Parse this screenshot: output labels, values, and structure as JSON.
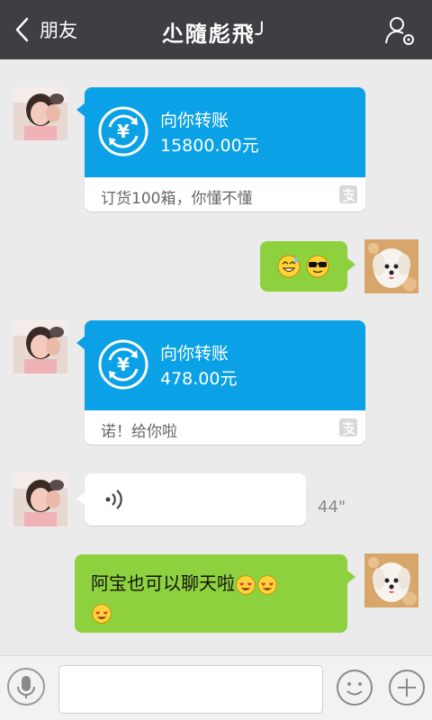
{
  "header": {
    "back_label": "朋友",
    "title": "尐隨彪飛╯"
  },
  "messages": [
    {
      "type": "transfer",
      "from": "friend",
      "label": "向你转账",
      "amount": "15800.00元",
      "note": "订货100箱，你懂不懂"
    },
    {
      "type": "emoji",
      "from": "me",
      "emojis": [
        "laughing-sweat-emoji",
        "sunglasses-emoji"
      ]
    },
    {
      "type": "transfer",
      "from": "friend",
      "label": "向你转账",
      "amount": "478.00元",
      "note": "诺！给你啦"
    },
    {
      "type": "voice",
      "from": "friend",
      "duration": "44\""
    },
    {
      "type": "text",
      "from": "me",
      "text": "阿宝也可以聊天啦",
      "emojis": [
        "heart-eyes-emoji",
        "heart-eyes-emoji",
        "heart-eyes-emoji"
      ]
    }
  ],
  "colors": {
    "header_bg": "#3e3e43",
    "chat_bg": "#ebebeb",
    "transfer_blue": "#0ba1e6",
    "my_bubble_green": "#8ed13f"
  },
  "icons": [
    "back-arrow-icon",
    "profile-settings-icon",
    "currency-exchange-icon",
    "alipay-icon",
    "voice-waves-icon",
    "microphone-icon",
    "emoji-face-icon",
    "plus-icon"
  ]
}
